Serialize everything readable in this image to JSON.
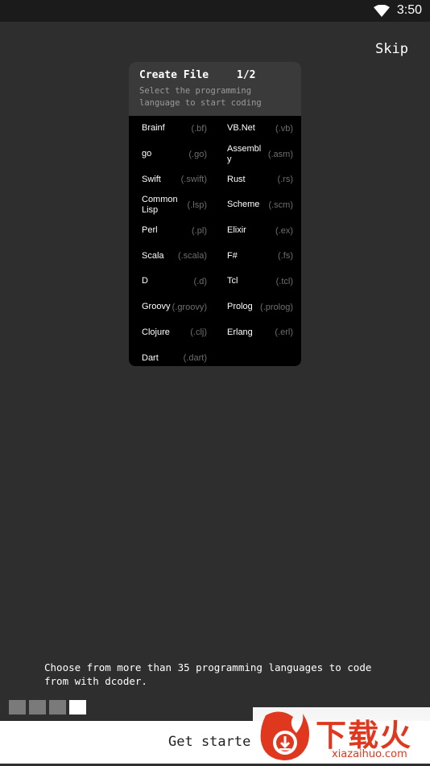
{
  "status_bar": {
    "time": "3:50",
    "wifi_icon": "wifi-icon"
  },
  "skip_label": "Skip",
  "card": {
    "title": "Create File",
    "page": "1/2",
    "subtitle": "Select the programming language to start coding",
    "languages": [
      {
        "name": "Brainf",
        "ext": "(.bf)"
      },
      {
        "name": "VB.Net",
        "ext": "(.vb)"
      },
      {
        "name": "go",
        "ext": "(.go)"
      },
      {
        "name": "Assembly",
        "ext": "(.asm)"
      },
      {
        "name": "Swift",
        "ext": "(.swift)"
      },
      {
        "name": "Rust",
        "ext": "(.rs)"
      },
      {
        "name": "Common Lisp",
        "ext": "(.lsp)"
      },
      {
        "name": "Scheme",
        "ext": "(.scm)"
      },
      {
        "name": "Perl",
        "ext": "(.pl)"
      },
      {
        "name": "Elixir",
        "ext": "(.ex)"
      },
      {
        "name": "Scala",
        "ext": "(.scala)"
      },
      {
        "name": "F#",
        "ext": "(.fs)"
      },
      {
        "name": "D",
        "ext": "(.d)"
      },
      {
        "name": "Tcl",
        "ext": "(.tcl)"
      },
      {
        "name": "Groovy",
        "ext": "(.groovy)"
      },
      {
        "name": "Prolog",
        "ext": "(.prolog)"
      },
      {
        "name": "Clojure",
        "ext": "(.clj)"
      },
      {
        "name": "Erlang",
        "ext": "(.erl)"
      },
      {
        "name": "Dart",
        "ext": "(.dart)"
      }
    ]
  },
  "description": "Choose from more than 35 programming languages to code from with dcoder.",
  "pager": {
    "total": 4,
    "active_index": 3
  },
  "get_started_label": "Get starte",
  "watermark": {
    "text_cn": "下载火",
    "url": "xiazaihuo.com",
    "logo_icon": "download-flame-logo"
  },
  "colors": {
    "background": "#2e2e2e",
    "card_header": "#3a3a3a",
    "card_body": "#000000",
    "accent_watermark": "#e0381e"
  }
}
